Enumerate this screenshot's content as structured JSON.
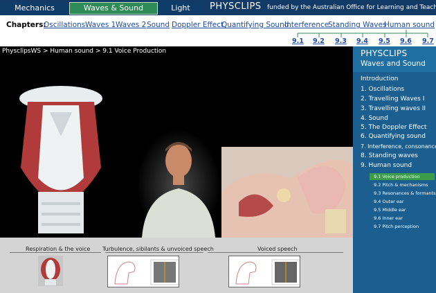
{
  "topnav": {
    "mechanics": "Mechanics",
    "waves_sound": "Waves & Sound",
    "light": "Light",
    "brand": "PHYSCLIPS",
    "funded": "funded by the Australian Office for Learning and Teaching"
  },
  "chapters": {
    "label": "Chapters:",
    "items": [
      "Oscillations",
      "Waves 1",
      "Waves 2",
      "Sound",
      "Doppler Effect",
      "Quantifying Sound",
      "Interference",
      "Standing Waves",
      "Human sound"
    ],
    "subs": [
      "9.1",
      "9.2",
      "9.3",
      "9.4",
      "9.5",
      "9.6",
      "9.7"
    ]
  },
  "breadcrumb": "PhysclipsWS > Human sound > 9.1 Voice Production",
  "sidebar": {
    "title": "PHYSCLIPS",
    "subtitle": "Waves and Sound",
    "items": [
      "Introduction",
      "1. Oscillations",
      "2. Travelling Waves I",
      "3. Travelling waves II",
      "4. Sound",
      "5. The Doppler Effect",
      "6. Quantifying sound",
      "7. Interference, consonance",
      "8. Standing waves",
      "9. Human sound"
    ],
    "subitems": [
      "9.1 Voice production",
      "9.2 Pitch & mechanisms",
      "9.3 Resonances & formants",
      "9.4 Outer ear",
      "9.5 Middle ear",
      "9.6 Inner ear",
      "9.7 Pitch perception"
    ]
  },
  "bottom": {
    "section1": "Respiration & the voice",
    "section2": "Turbulence, sibilants & unvoiced speech",
    "section3": "Voiced speech"
  },
  "colors": {
    "nav_bg": "#123a66",
    "active_tab": "#2e8b57",
    "link": "#1f4aa8",
    "sidebar_bg": "#1a5f8f",
    "sidebar_active": "#3c9c4a"
  }
}
